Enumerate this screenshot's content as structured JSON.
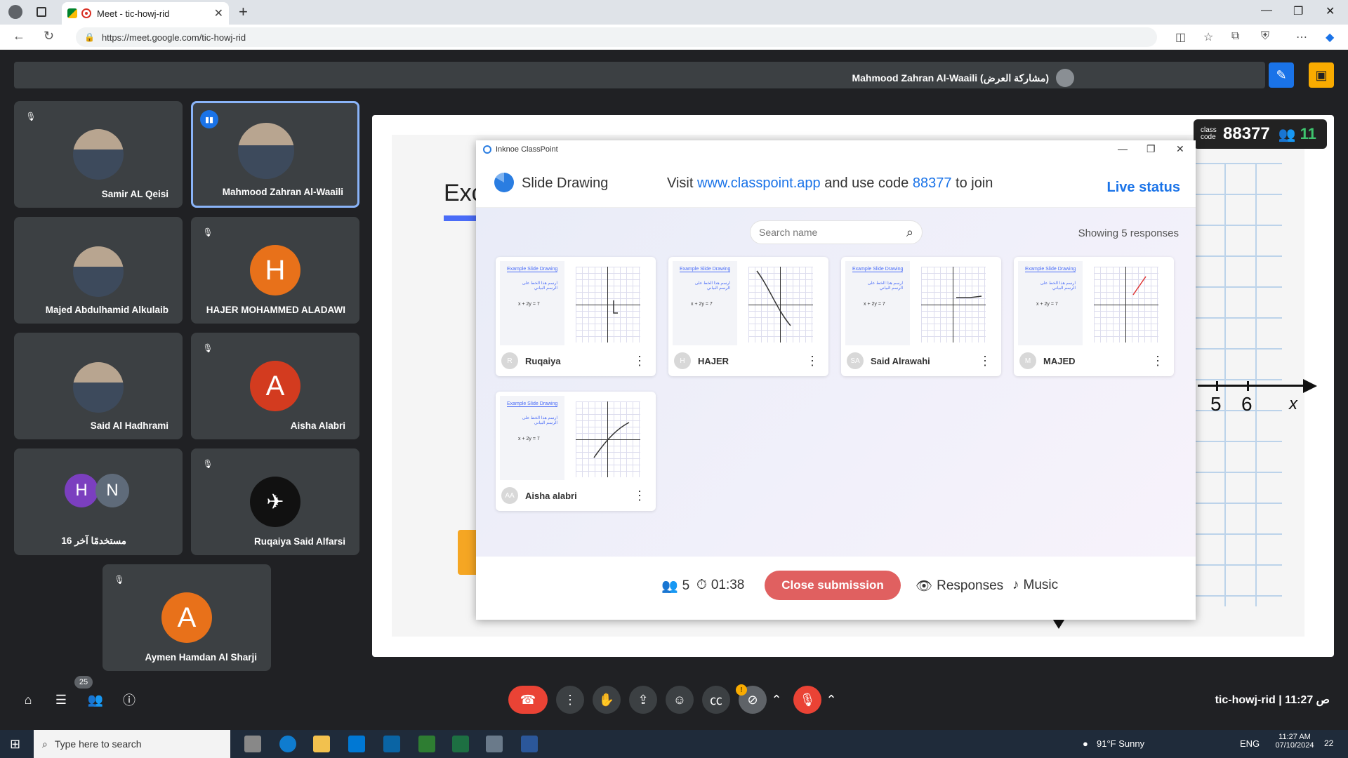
{
  "browser": {
    "tab_title": "Meet - tic-howj-rid",
    "url": "https://meet.google.com/tic-howj-rid",
    "new_tab": "+",
    "win_min": "—",
    "win_max": "❐",
    "win_close": "✕"
  },
  "meet": {
    "presenter_text": "Mahmood Zahran Al-Waaili (مشاركة العرض)",
    "participants": [
      {
        "name": "Samir AL Qeisi"
      },
      {
        "name": "Mahmood Zahran Al-Waaili"
      },
      {
        "name": "Majed Abdulhamid Alkulaib"
      },
      {
        "name": "HAJER MOHAMMED ALADAWI",
        "initial": "H"
      },
      {
        "name": "Said Al Hadhrami"
      },
      {
        "name": "Aisha Alabri",
        "initial": "A"
      },
      {
        "name": "16 مستخدمًا آخر",
        "initials": [
          "H",
          "N"
        ]
      },
      {
        "name": "Ruqaiya Said Alfarsi"
      },
      {
        "name": "Aymen Hamdan Al Sharji",
        "initial": "A"
      }
    ],
    "participants_badge": "25",
    "meeting_code": "tic-howj-rid",
    "time": "11:27 ص",
    "separator": "|",
    "alert": "!"
  },
  "slide": {
    "title_partial": "Exc",
    "axis_numbers": [
      "5",
      "6"
    ],
    "axis_var": "x",
    "class_code_label": "class code",
    "class_code": "88377",
    "joined_count": "11"
  },
  "classpoint": {
    "window_title": "Inknoe ClassPoint",
    "activity": "Slide Drawing",
    "visit_prefix": "Visit ",
    "visit_url": "www.classpoint.app",
    "visit_mid": " and use code ",
    "visit_code": "88377",
    "visit_suffix": " to join",
    "live_status": "Live status",
    "search_placeholder": "Search name",
    "showing": "Showing 5 responses",
    "thumb_title": "Example Slide Drawing",
    "thumb_arabic": "ارسم هذا الخط على الرسم البياني",
    "thumb_eq": "x + 2y = 7",
    "responses": [
      {
        "name": "Ruqaiya",
        "avatar": "R"
      },
      {
        "name": "HAJER",
        "avatar": "H"
      },
      {
        "name": "Said Alrawahi",
        "avatar": "SA"
      },
      {
        "name": "MAJED",
        "avatar": "M"
      },
      {
        "name": "Aisha alabri",
        "avatar": "AA"
      }
    ],
    "footer": {
      "count": "5",
      "timer": "01:38",
      "close": "Close submission",
      "responses": "Responses",
      "music": "Music"
    }
  },
  "taskbar": {
    "search_placeholder": "Type here to search",
    "weather": "91°F  Sunny",
    "lang": "ENG",
    "time": "11:27 AM",
    "date": "07/10/2024",
    "notif": "22"
  },
  "colors": {
    "meet_bg": "#202124",
    "tile_bg": "#3c4043",
    "accent_blue": "#1a73e8",
    "end_call_red": "#ea4335",
    "close_submission": "#e06060",
    "join_green": "#3ec46d"
  },
  "icons": {
    "profile": "profile-icon",
    "mic_off": "mic-off-icon",
    "search": "search-icon",
    "more": "more-vertical-icon",
    "end_call": "end-call-icon",
    "raise_hand": "raise-hand-icon"
  }
}
